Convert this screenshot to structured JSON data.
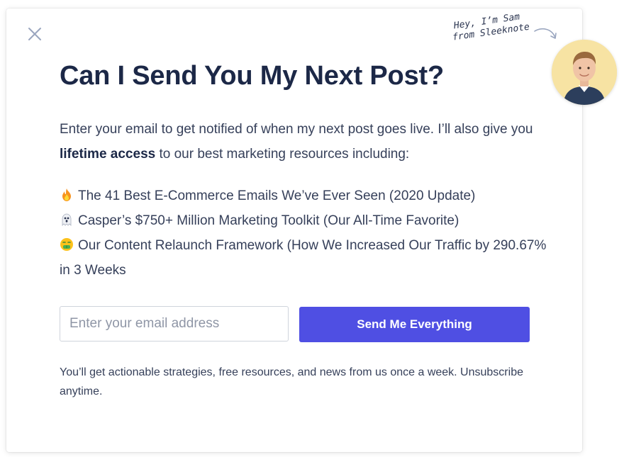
{
  "popup": {
    "close_icon": "close-icon",
    "headline": "Can I Send You My Next Post?",
    "intro_before": "Enter your email to get notified of when my next post goes live. I’ll also give you ",
    "intro_bold": "lifetime access",
    "intro_after": " to our best marketing resources including:",
    "resources": [
      {
        "icon": "fire-emoji-icon",
        "text": "The 41 Best E-Commerce Emails We’ve Ever Seen (2020 Update)"
      },
      {
        "icon": "ghost-emoji-icon",
        "text": "Casper’s $750+ Million Marketing Toolkit (Our All-Time Favorite)"
      },
      {
        "icon": "money-mouth-emoji-icon",
        "text": "Our Content Relaunch Framework (How We Increased Our Traffic by 290.67% in 3 Weeks"
      }
    ],
    "email_placeholder": "Enter your email address",
    "email_value": "",
    "submit_label": "Send Me Everything",
    "footnote": "You’ll get actionable strategies, free resources, and news from us once a week. Unsubscribe anytime.",
    "handwritten_line1": "Hey, I’m Sam",
    "handwritten_line2": "from Sleeknote",
    "avatar_icon": "avatar"
  },
  "colors": {
    "heading": "#1c2847",
    "body_text": "#36405a",
    "accent_button": "#4f4fe3",
    "close_icon": "#9aa6bf",
    "avatar_bg": "#f7e3a3"
  }
}
